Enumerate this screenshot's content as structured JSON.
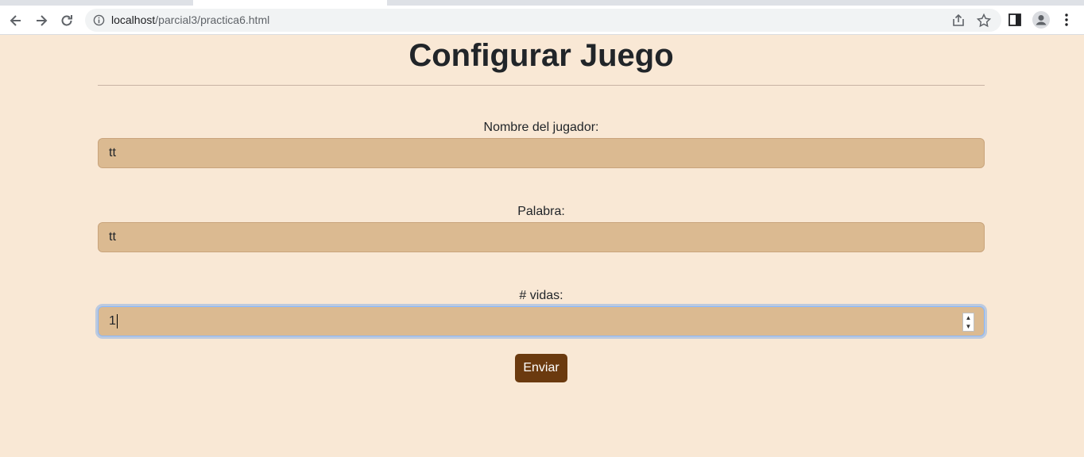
{
  "browser": {
    "url_host": "localhost",
    "url_path": "/parcial3/practica6.html"
  },
  "page": {
    "title": "Configurar Juego"
  },
  "form": {
    "fields": [
      {
        "label": "Nombre del jugador:",
        "value": "tt"
      },
      {
        "label": "Palabra:",
        "value": "tt"
      },
      {
        "label": "# vidas:",
        "value": "1"
      }
    ],
    "submit_label": "Enviar"
  },
  "colors": {
    "page_background": "#f9e8d5",
    "input_background": "#dbba91",
    "button_background": "#6b3a0f"
  }
}
